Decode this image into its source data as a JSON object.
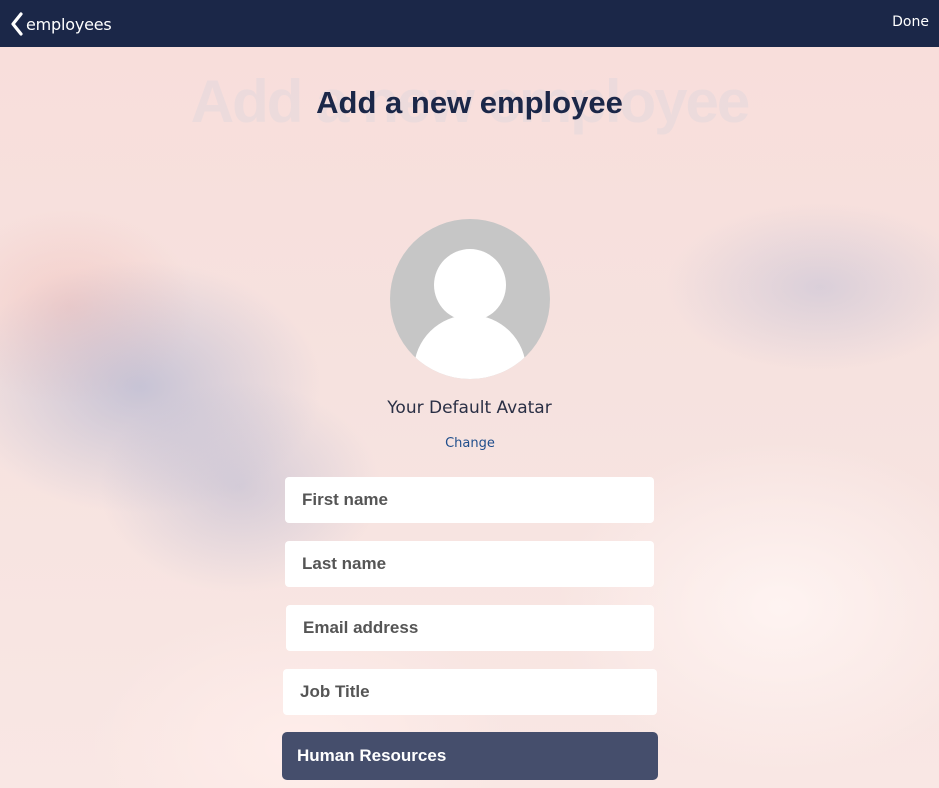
{
  "header": {
    "back_label": "employees",
    "done_label": "Done"
  },
  "page": {
    "background_title": "Add a new employee",
    "title": "Add a new employee"
  },
  "avatar": {
    "caption": "Your Default Avatar",
    "change_label": "Change"
  },
  "form": {
    "first_name_placeholder": "First name",
    "last_name_placeholder": "Last name",
    "email_placeholder": "Email address",
    "job_title_placeholder": "Job Title",
    "department_value": "Human Resources"
  },
  "colors": {
    "header_bg": "#1b2748",
    "title": "#1b2748",
    "link": "#1f4e8c",
    "select_bg": "#454e6c"
  }
}
